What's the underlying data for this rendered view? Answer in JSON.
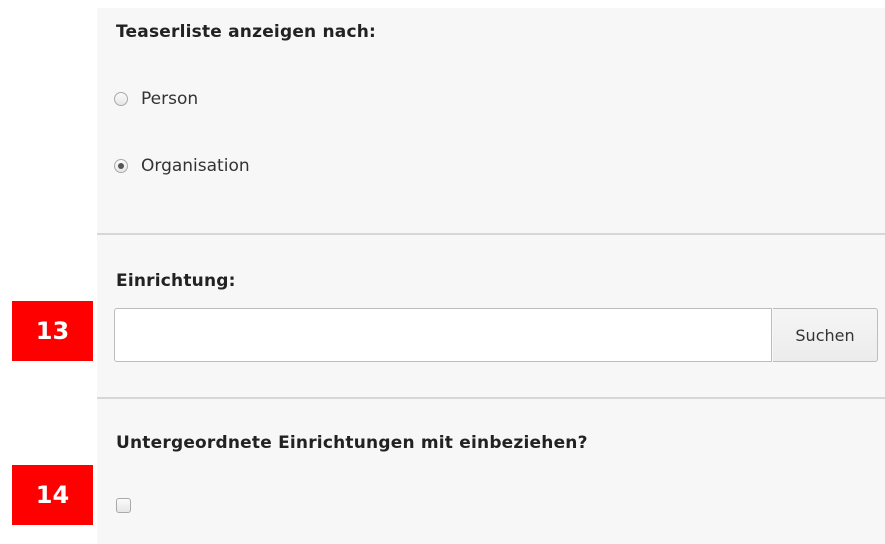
{
  "display_by": {
    "label": "Teaserliste anzeigen nach:",
    "options": [
      {
        "label": "Person",
        "checked": false
      },
      {
        "label": "Organisation",
        "checked": true
      }
    ]
  },
  "institution": {
    "label": "Einrichtung:",
    "input_value": "",
    "search_button_label": "Suchen"
  },
  "subordinate": {
    "label": "Untergeordnete Einrichtungen mit einbeziehen?",
    "checked": false
  },
  "annotations": {
    "badge_13": "13",
    "badge_14": "14"
  },
  "colors": {
    "badge": "#ff0000",
    "panel_background": "#f7f7f7"
  }
}
